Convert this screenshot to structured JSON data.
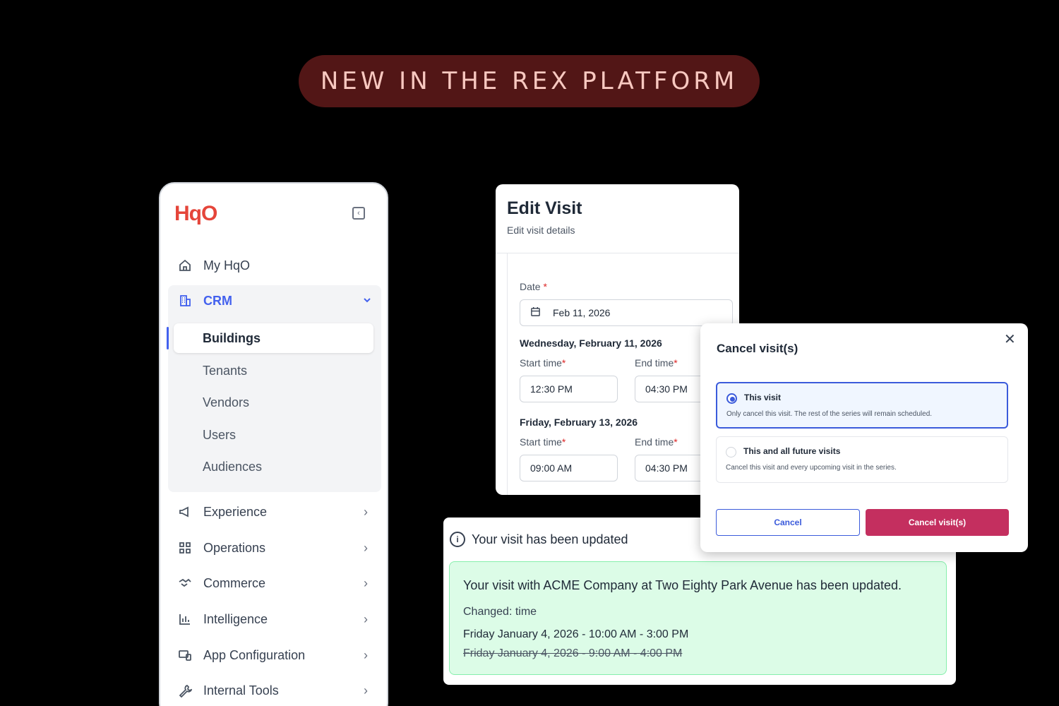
{
  "banner": {
    "text": "NEW IN THE REX PLATFORM"
  },
  "sidebar": {
    "logo": "HqO",
    "items_top": [
      {
        "label": "My HqO",
        "icon": "home-icon"
      }
    ],
    "crm": {
      "label": "CRM",
      "icon": "building-icon",
      "subitems": [
        "Buildings",
        "Tenants",
        "Vendors",
        "Users",
        "Audiences"
      ],
      "active": "Buildings"
    },
    "items": [
      {
        "label": "Experience",
        "icon": "megaphone-icon"
      },
      {
        "label": "Operations",
        "icon": "grid-icon"
      },
      {
        "label": "Commerce",
        "icon": "handshake-icon"
      },
      {
        "label": "Intelligence",
        "icon": "bar-chart-icon"
      },
      {
        "label": "App Configuration",
        "icon": "devices-icon"
      },
      {
        "label": "Internal Tools",
        "icon": "wrench-icon"
      }
    ]
  },
  "edit_visit": {
    "title": "Edit Visit",
    "subtitle": "Edit visit details",
    "date_label": "Date",
    "date_value": "Feb 11, 2026",
    "days": [
      {
        "heading": "Wednesday, February 11, 2026",
        "start_label": "Start time",
        "end_label": "End time",
        "start": "12:30 PM",
        "end": "04:30 PM"
      },
      {
        "heading": "Friday, February 13, 2026",
        "start_label": "Start time",
        "end_label": "End time",
        "start": "09:00 AM",
        "end": "04:30 PM"
      }
    ],
    "required_mark": "*"
  },
  "cancel_modal": {
    "title": "Cancel visit(s)",
    "close": "✕",
    "options": [
      {
        "title": "This visit",
        "desc": "Only cancel this visit. The rest of the series will remain scheduled.",
        "selected": true
      },
      {
        "title": "This and all future visits",
        "desc": "Cancel this visit and every upcoming visit in the series.",
        "selected": false
      }
    ],
    "cancel_label": "Cancel",
    "confirm_label": "Cancel visit(s)",
    "accent": "#3b5bdb",
    "danger": "#c42f5f"
  },
  "notification": {
    "icon": "info-icon",
    "title": "Your visit has been updated",
    "message": "Your visit with ACME Company at Two Eighty Park Avenue has been updated.",
    "changed": "Changed: time",
    "new_time": "Friday January 4, 2026 - 10:00 AM - 3:00 PM",
    "old_time": "Friday January 4, 2026 - 9:00 AM - 4:00 PM"
  }
}
